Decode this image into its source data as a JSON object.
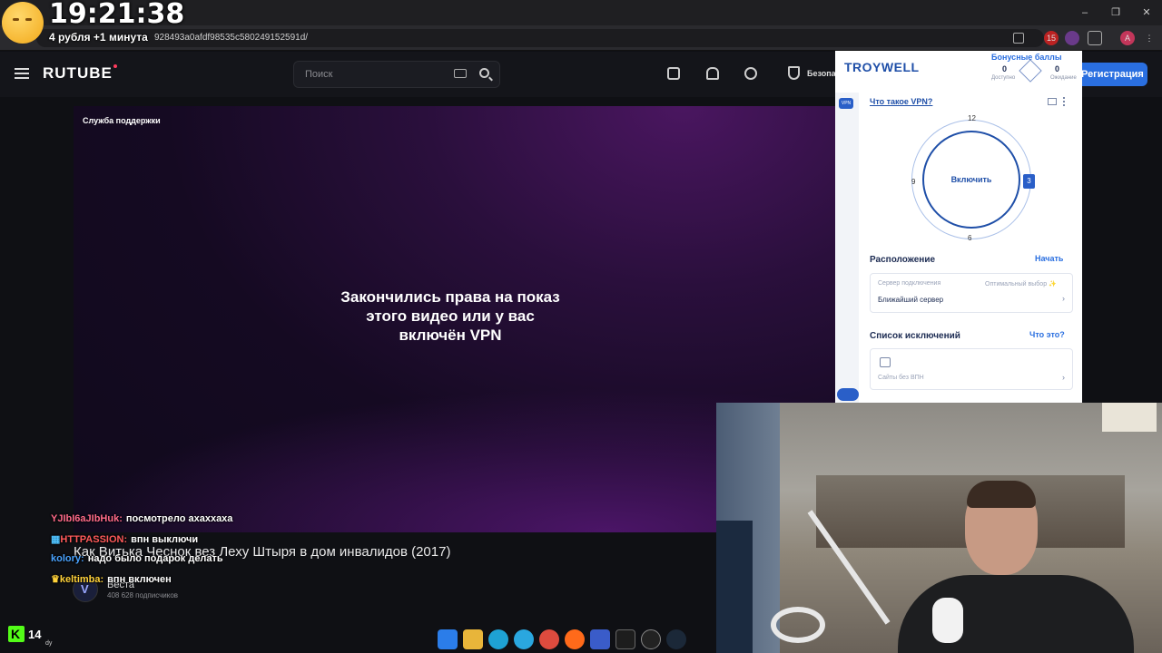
{
  "overlay": {
    "time": "19:21:38",
    "subtitle": "4 рубля +1 минута"
  },
  "browser": {
    "url_fragment": "928493a0afdf98535c580249152591d/",
    "new_tab": "+",
    "window_controls": [
      "–",
      "❐",
      "✕"
    ],
    "ext_badge": "15",
    "profile_initial": "A"
  },
  "header": {
    "logo": "RUTUBE",
    "search_placeholder": "Поиск",
    "secure_label": "Безопа",
    "register_button": "Регистрация"
  },
  "player": {
    "support_label": "Служба поддержки",
    "message": "Закончились права на показ этого видео или у вас включён VPN"
  },
  "video": {
    "title": "Как Витька Чеснок вез Леху Штыря в дом инвалидов (2017)",
    "channel_name": "Веста",
    "subscribers": "408 628 подписчиков"
  },
  "chat": [
    {
      "nick": "YJIbI6aJIbHuk:",
      "text": "посмотрело ахаххаха",
      "color": "#ff6b8a",
      "badge": ""
    },
    {
      "nick": "HTTPASSION:",
      "text": "впн выключи",
      "color": "#ff5a5a",
      "badge": "▦"
    },
    {
      "nick": "kolory:",
      "text": "надо было подарок делать",
      "color": "#4aa3ff",
      "badge": ""
    },
    {
      "nick": "keltimba:",
      "text": "впн включен",
      "color": "#ffd23a",
      "badge": "♛"
    }
  ],
  "vpn": {
    "logo": "TROYWELL",
    "bonus_title": "Бонусные баллы",
    "available_value": "0",
    "available_label": "Доступно",
    "waiting_value": "0",
    "waiting_label": "Ожидание",
    "side_badge": "VPN",
    "what_is_vpn": "Что такое VPN?",
    "connect_label": "Включить",
    "dial": {
      "top": "12",
      "right": "3",
      "bottom": "6",
      "left": "9"
    },
    "location_title": "Расположение",
    "start_link": "Начать",
    "server_label": "Сервер подключения",
    "server_optimal": "Оптимальный выбор ✨",
    "server_value": "Ближайший сервер",
    "exclusions_title": "Список исключений",
    "whats_that": "Что это?",
    "exclusions_placeholder": "Сайты без ВПН",
    "brand_color": "#1f4fa8"
  },
  "stream": {
    "platform_count": "14",
    "platform_sub": "dy"
  }
}
